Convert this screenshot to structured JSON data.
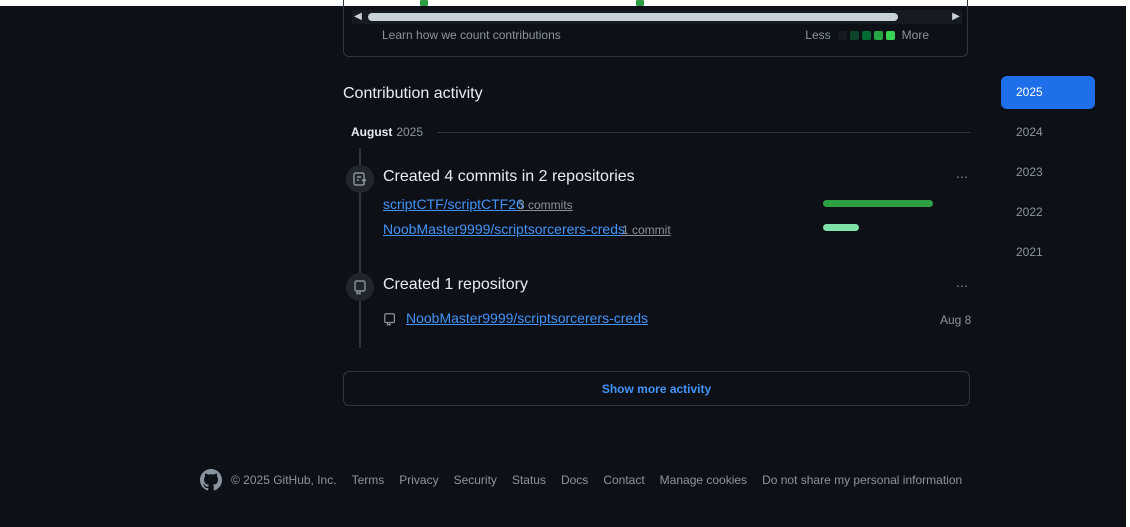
{
  "graph": {
    "learn_link": "Learn how we count contributions",
    "legend_less": "Less",
    "legend_more": "More",
    "legend_colors": [
      "#161b22",
      "#0e4429",
      "#006d32",
      "#26a641",
      "#39d353"
    ]
  },
  "activity": {
    "title": "Contribution activity",
    "month": "August",
    "year": "2025",
    "commits_item": {
      "title": "Created 4 commits in 2 repositories",
      "repos": [
        {
          "name": "scriptCTF/scriptCTF26",
          "count": "3 commits",
          "fraction": 1.0
        },
        {
          "name": "NoobMaster9999/scriptsorcerers-creds",
          "count": "1 commit",
          "fraction": 0.33
        }
      ]
    },
    "repo_item": {
      "title": "Created 1 repository",
      "repo": "NoobMaster9999/scriptsorcerers-creds",
      "date": "Aug 8"
    },
    "show_more": "Show more activity"
  },
  "years": [
    "2025",
    "2024",
    "2023",
    "2022",
    "2021"
  ],
  "footer": {
    "copyright": "© 2025 GitHub, Inc.",
    "links": [
      "Terms",
      "Privacy",
      "Security",
      "Status",
      "Docs",
      "Contact",
      "Manage cookies",
      "Do not share my personal information"
    ]
  },
  "colors": {
    "accent": "#1f6feb",
    "link": "#4493f8",
    "bar_dark": "#2ea043",
    "bar_light": "#7ee2a8"
  }
}
